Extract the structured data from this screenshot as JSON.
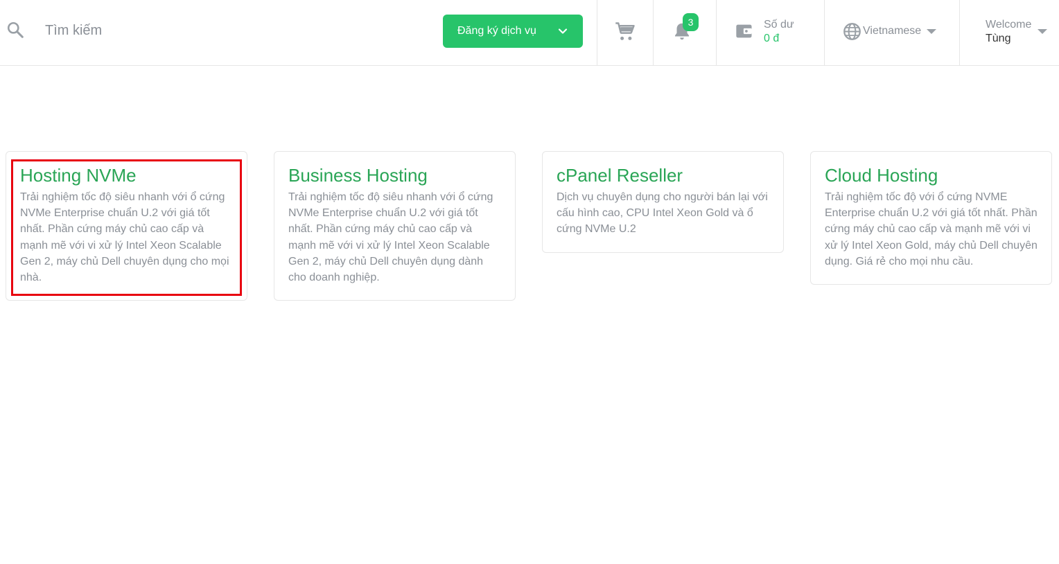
{
  "header": {
    "search": {
      "placeholder": "Tìm kiếm",
      "icon": "search-icon"
    },
    "register_button": {
      "label": "Đăng ký dịch vụ",
      "icon": "chevron-down-icon"
    },
    "cart": {
      "icon": "cart-icon"
    },
    "notifications": {
      "icon": "bell-icon",
      "count": "3"
    },
    "balance": {
      "icon": "wallet-icon",
      "label": "Số dư",
      "value": "0 đ"
    },
    "language": {
      "icon": "globe-icon",
      "label": "Vietnamese"
    },
    "user": {
      "welcome": "Welcome",
      "name": "Tùng"
    }
  },
  "colors": {
    "accent": "#27c46a",
    "title": "#2aa556",
    "muted": "#8a8f96",
    "highlight": "#e8000f"
  },
  "cards": [
    {
      "title": "Hosting NVMe",
      "description": "Trải nghiệm tốc độ siêu nhanh với ổ cứng NVMe Enterprise chuẩn U.2 với giá tốt nhất. Phần cứng máy chủ cao cấp và mạnh mẽ với vi xử lý Intel Xeon Scalable Gen 2, máy chủ Dell chuyên dụng cho mọi nhà."
    },
    {
      "title": "Business Hosting",
      "description": "Trải nghiệm tốc độ siêu nhanh với ổ cứng NVMe Enterprise chuẩn U.2 với giá tốt nhất. Phần cứng máy chủ cao cấp và mạnh mẽ với vi xử lý Intel Xeon Scalable Gen 2, máy chủ Dell chuyên dụng dành cho doanh nghiệp."
    },
    {
      "title": "cPanel Reseller",
      "description": "Dịch vụ chuyên dụng cho người bán lại với cấu hình cao, CPU Intel Xeon Gold và ổ cứng NVMe U.2"
    },
    {
      "title": "Cloud Hosting",
      "description": "Trải nghiệm tốc độ với ổ cứng NVME Enterprise chuẩn U.2 với giá tốt nhất. Phần cứng máy chủ cao cấp và mạnh mẽ với vi xử lý Intel Xeon Gold, máy chủ Dell chuyên dụng. Giá rẻ cho mọi nhu cầu."
    }
  ]
}
